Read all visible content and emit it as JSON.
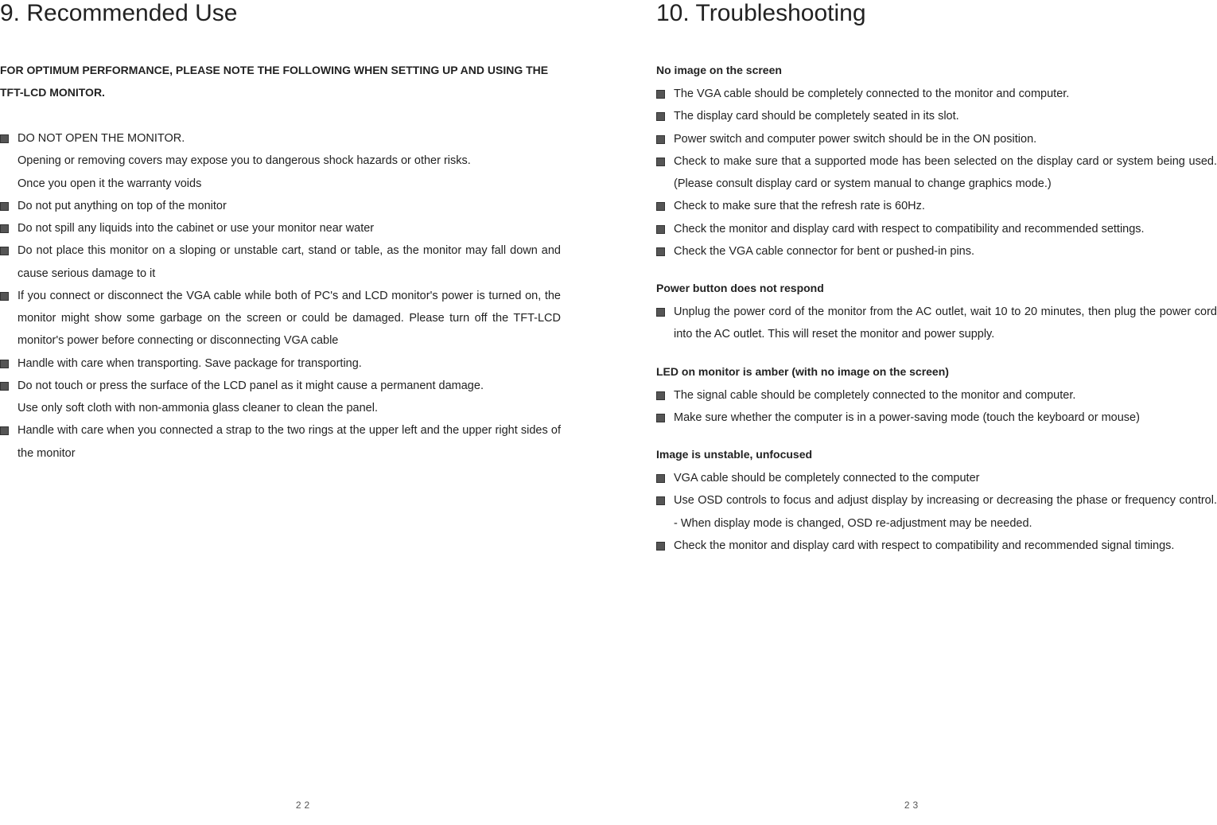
{
  "left": {
    "heading": "9. Recommended Use",
    "intro": "FOR OPTIMUM PERFORMANCE, PLEASE NOTE THE FOLLOWING WHEN SETTING UP AND USING THE TFT-LCD MONITOR.",
    "items": [
      "DO NOT OPEN THE MONITOR.",
      "Opening or removing covers may expose you to dangerous shock hazards or other risks.",
      "Once you open it the warranty voids",
      "Do not put anything on top of the monitor",
      "Do not spill any liquids into the cabinet or use your monitor near water",
      "Do not place this monitor on a sloping or unstable cart, stand or table, as the monitor may fall down and cause serious damage to it",
      "If you connect or disconnect the VGA cable while both of PC's and LCD monitor's power is turned on, the monitor might show some garbage on the screen or could be damaged. Please turn off the TFT-LCD monitor's power before connecting or disconnecting VGA cable",
      "Handle with care when transporting. Save package for transporting.",
      "Do not touch or press the surface of the LCD panel as it might cause a permanent damage.",
      "Use only soft cloth with non-ammonia glass cleaner to clean the panel.",
      "Handle with care when you connected a strap to the two rings at the upper left and the upper right sides of the monitor"
    ],
    "page_num": "22"
  },
  "right": {
    "heading": "10. Troubleshooting",
    "sections": [
      {
        "title": "No image on the screen",
        "items": [
          "The VGA cable should be completely connected to the monitor and computer.",
          "The display card should be completely seated in its slot.",
          "Power switch and computer power switch should be in the ON position.",
          "Check to make sure that a supported mode has been selected on the display card or system being used. (Please consult display card or system manual to change graphics mode.)",
          "Check to make sure that the refresh rate is 60Hz.",
          "Check the monitor and display card with respect to compatibility and recommended settings.",
          "Check the VGA cable connector for bent or pushed-in pins."
        ]
      },
      {
        "title": "Power button does not respond",
        "items": [
          "Unplug the power cord of the monitor from the AC outlet, wait 10 to 20 minutes, then plug the power cord into the AC outlet. This will reset the monitor and power supply."
        ]
      },
      {
        "title": "LED on monitor is amber (with no image on the screen)",
        "items": [
          "The signal cable should be completely connected to the monitor and computer.",
          "Make sure whether the computer is in a power-saving mode (touch the keyboard or mouse)"
        ]
      },
      {
        "title": "Image is unstable, unfocused",
        "items": [
          "VGA cable should be completely connected to the computer",
          "Use OSD controls to focus and adjust display by increasing or decreasing the phase or frequency control. - When display mode is changed, OSD re-adjustment may be needed.",
          "Check the monitor and display card with respect to compatibility and recommended signal timings."
        ]
      }
    ],
    "page_num": "23"
  }
}
